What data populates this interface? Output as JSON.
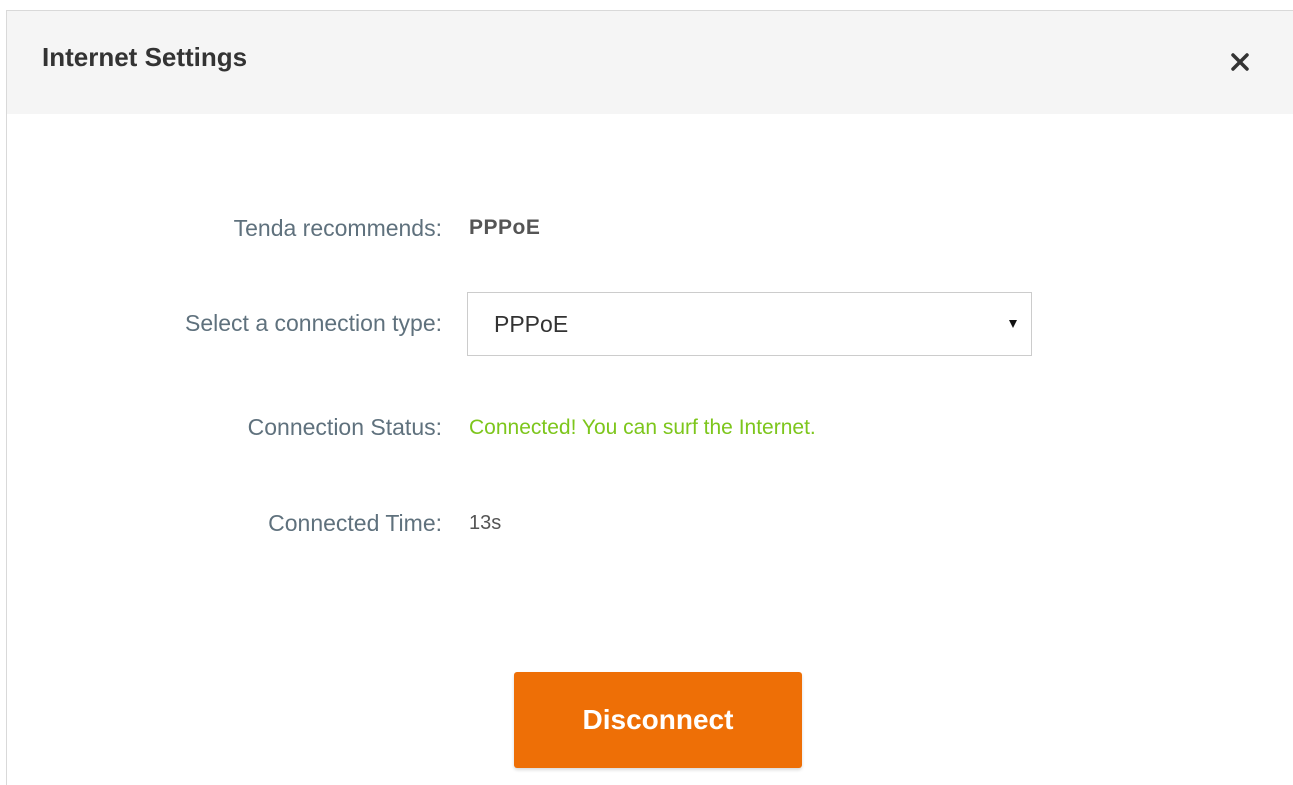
{
  "dialog": {
    "title": "Internet Settings",
    "close_icon": "close-icon"
  },
  "form": {
    "recommend_label": "Tenda recommends:",
    "recommend_value": "PPPoE",
    "connection_type_label": "Select a connection type:",
    "connection_type_value": "PPPoE",
    "connection_status_label": "Connection Status:",
    "connection_status_value": "Connected! You can surf the Internet.",
    "connected_time_label": "Connected Time:",
    "connected_time_value": "13s"
  },
  "actions": {
    "disconnect_label": "Disconnect"
  },
  "colors": {
    "accent": "#ee6f06",
    "status_ok": "#7dc61c",
    "header_bg": "#f5f5f5"
  }
}
